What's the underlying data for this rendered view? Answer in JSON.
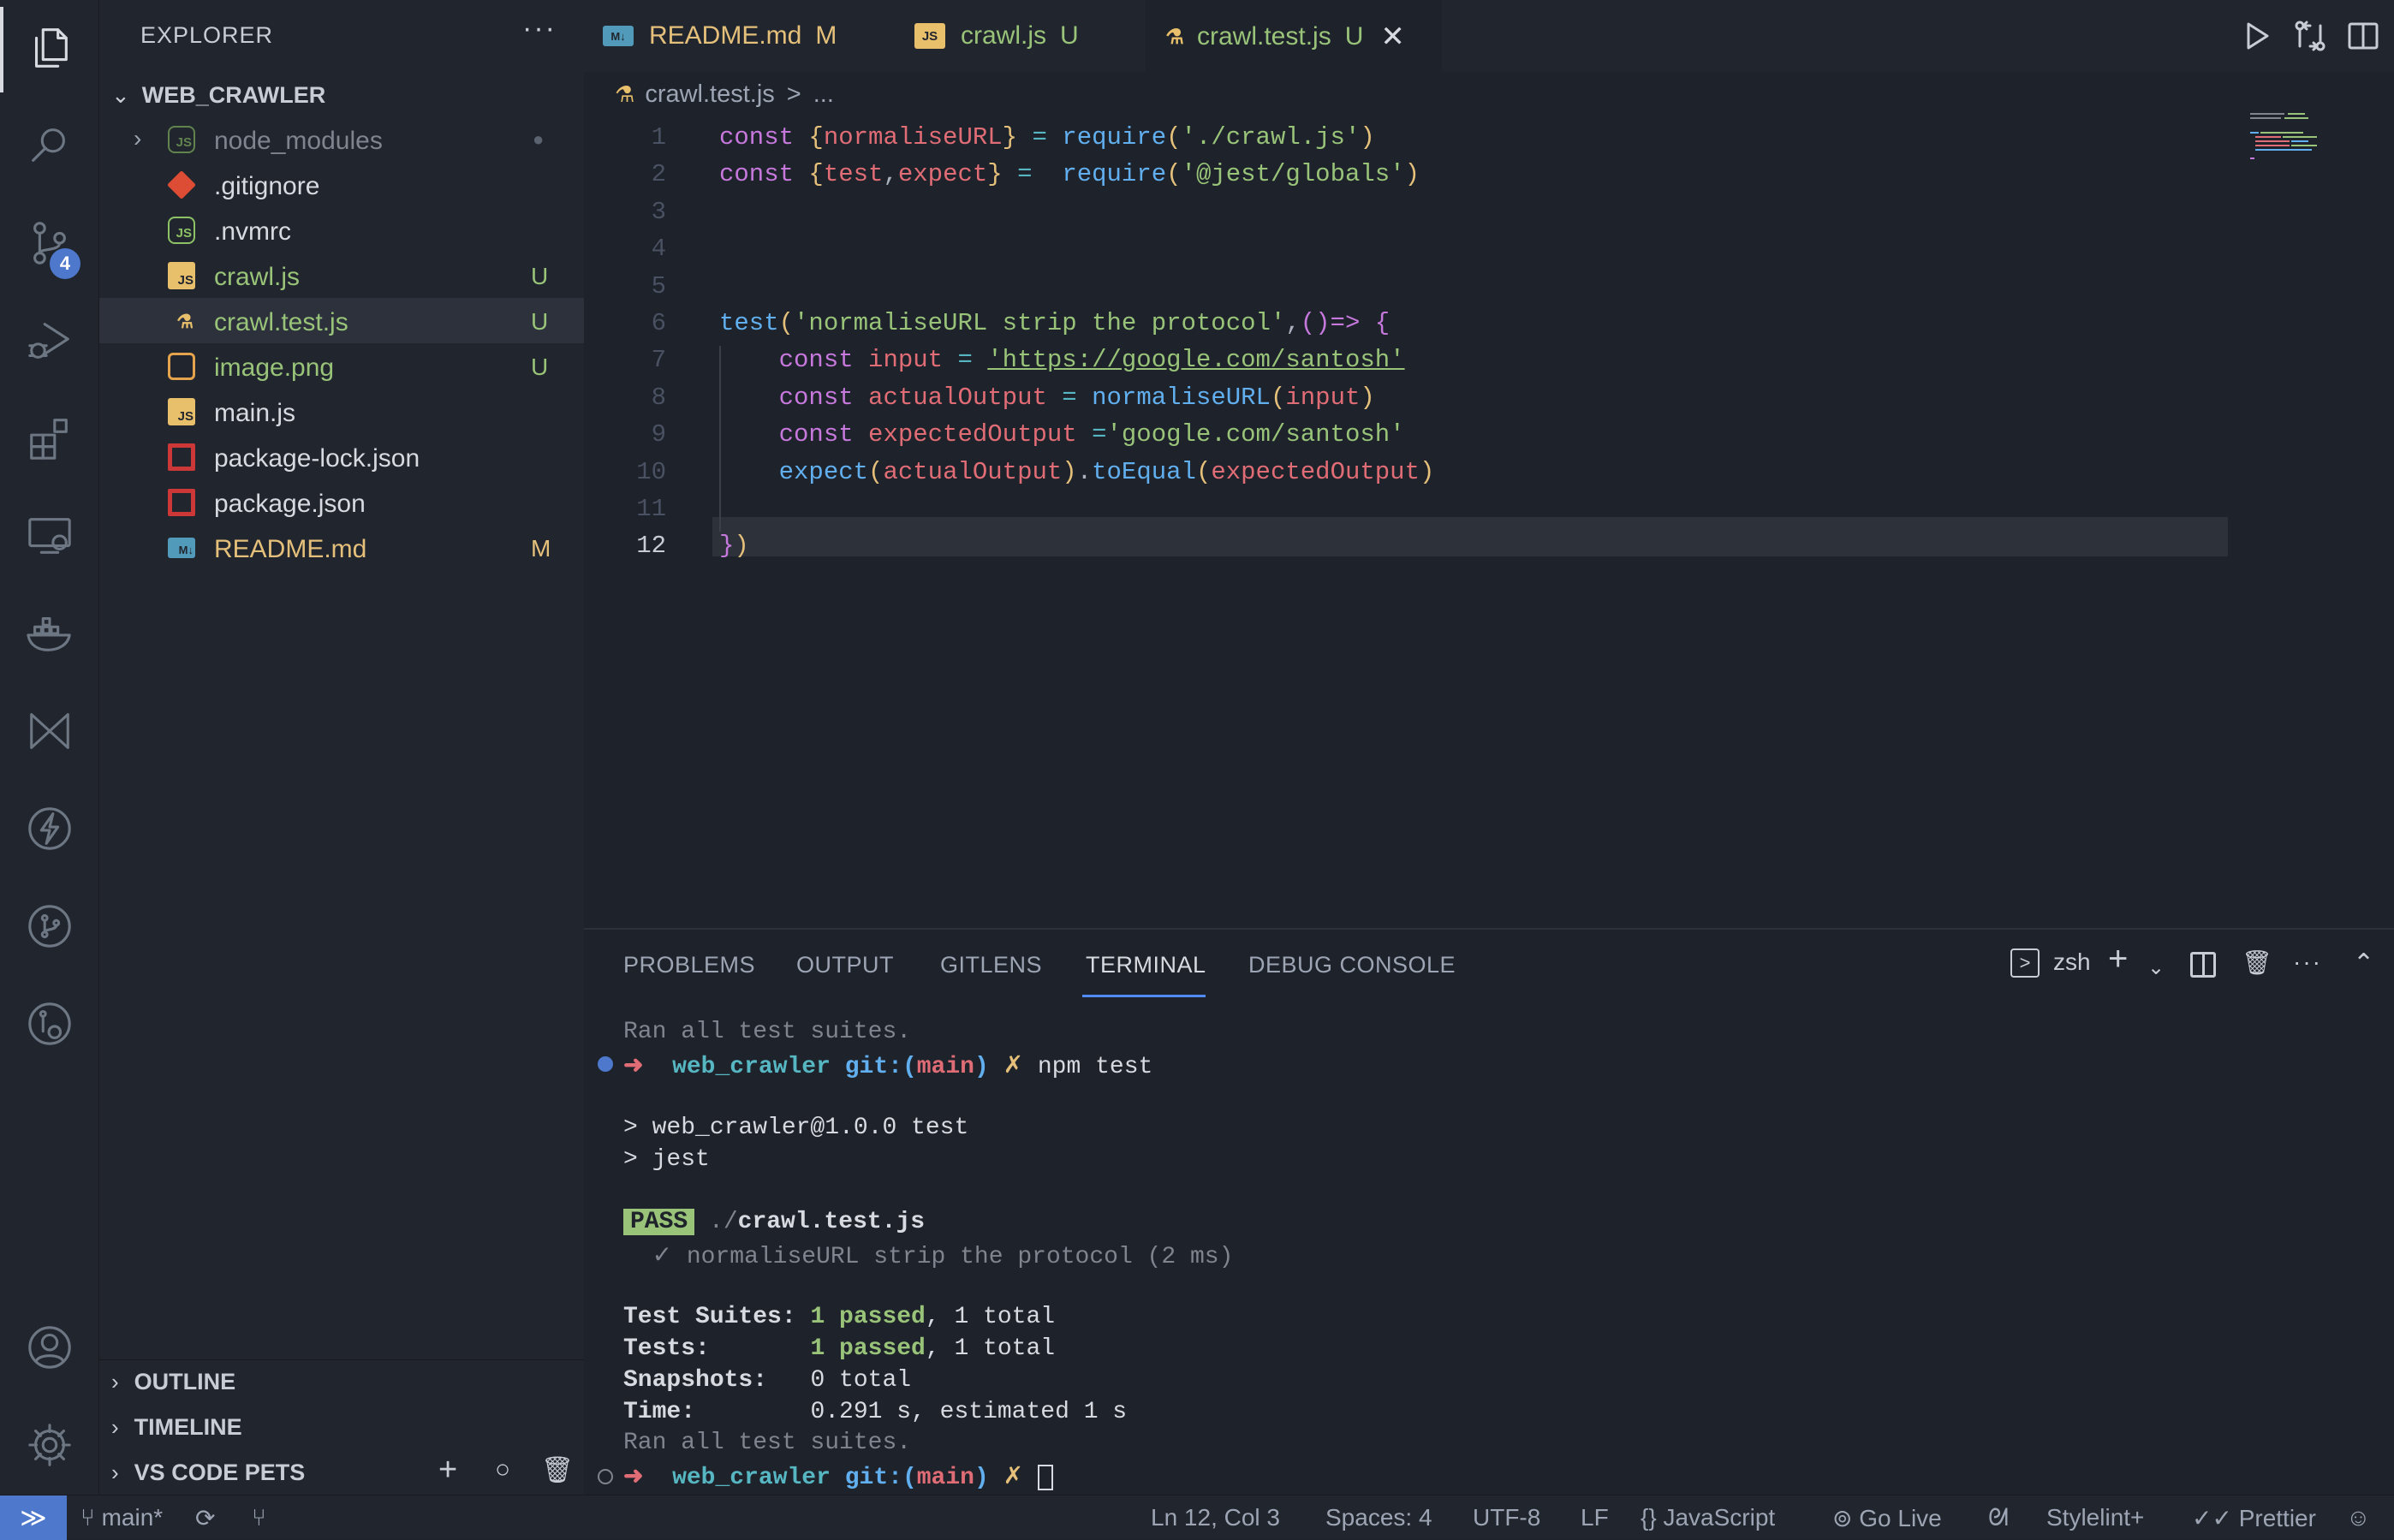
{
  "activity": {
    "scm_badge": "4"
  },
  "sidebar": {
    "title": "EXPLORER",
    "more": "···",
    "folder": "WEB_CRAWLER",
    "files": [
      {
        "name": "node_modules",
        "status": "●",
        "icon": "nodejs-icon"
      },
      {
        "name": ".gitignore",
        "status": "",
        "icon": "git-icon"
      },
      {
        "name": ".nvmrc",
        "status": "",
        "icon": "nodejs-icon"
      },
      {
        "name": "crawl.js",
        "status": "U",
        "icon": "javascript-icon"
      },
      {
        "name": "crawl.test.js",
        "status": "U",
        "icon": "test-js-icon"
      },
      {
        "name": "image.png",
        "status": "U",
        "icon": "image-icon"
      },
      {
        "name": "main.js",
        "status": "",
        "icon": "javascript-icon"
      },
      {
        "name": "package-lock.json",
        "status": "",
        "icon": "npm-icon"
      },
      {
        "name": "package.json",
        "status": "",
        "icon": "npm-icon"
      },
      {
        "name": "README.md",
        "status": "M",
        "icon": "markdown-icon"
      }
    ],
    "sections": [
      "OUTLINE",
      "TIMELINE",
      "VS CODE PETS"
    ]
  },
  "tabs": [
    {
      "label": "README.md",
      "status": "M",
      "icon": "M↓"
    },
    {
      "label": "crawl.js",
      "status": "U",
      "icon": "JS"
    },
    {
      "label": "crawl.test.js",
      "status": "U",
      "icon": "JS"
    }
  ],
  "breadcrumb": {
    "file": "crawl.test.js",
    "sep": ">",
    "rest": "..."
  },
  "editor": {
    "line_numbers": [
      "1",
      "2",
      "3",
      "4",
      "5",
      "6",
      "7",
      "8",
      "9",
      "10",
      "11",
      "12"
    ],
    "lines": [
      [
        [
          "k",
          "const "
        ],
        [
          "p",
          "{"
        ],
        [
          "v",
          "normaliseURL"
        ],
        [
          "p",
          "}"
        ],
        [
          "t",
          " "
        ],
        [
          "o",
          "="
        ],
        [
          "t",
          " "
        ],
        [
          "f",
          "require"
        ],
        [
          "p",
          "("
        ],
        [
          "s",
          "'./crawl.js'"
        ],
        [
          "p",
          ")"
        ]
      ],
      [
        [
          "k",
          "const "
        ],
        [
          "p",
          "{"
        ],
        [
          "v",
          "test"
        ],
        [
          "t",
          ","
        ],
        [
          "v",
          "expect"
        ],
        [
          "p",
          "}"
        ],
        [
          "t",
          " "
        ],
        [
          "o",
          "="
        ],
        [
          "t",
          "  "
        ],
        [
          "f",
          "require"
        ],
        [
          "p",
          "("
        ],
        [
          "s",
          "'@jest/globals'"
        ],
        [
          "p",
          ")"
        ]
      ],
      [],
      [],
      [],
      [
        [
          "f",
          "test"
        ],
        [
          "p",
          "("
        ],
        [
          "s",
          "'normaliseURL strip the protocol'"
        ],
        [
          "t",
          ","
        ],
        [
          "k",
          "()"
        ],
        [
          "k",
          "=>"
        ],
        [
          "t",
          " "
        ],
        [
          "k",
          "{"
        ]
      ],
      [
        [
          "t",
          "    "
        ],
        [
          "k",
          "const "
        ],
        [
          "v",
          "input"
        ],
        [
          "t",
          " "
        ],
        [
          "o",
          "="
        ],
        [
          "t",
          " "
        ],
        [
          "s",
          "'https://google.com/santosh'"
        ]
      ],
      [
        [
          "t",
          "    "
        ],
        [
          "k",
          "const "
        ],
        [
          "v",
          "actualOutput"
        ],
        [
          "t",
          " "
        ],
        [
          "o",
          "="
        ],
        [
          "t",
          " "
        ],
        [
          "f",
          "normaliseURL"
        ],
        [
          "p",
          "("
        ],
        [
          "v",
          "input"
        ],
        [
          "p",
          ")"
        ]
      ],
      [
        [
          "t",
          "    "
        ],
        [
          "k",
          "const "
        ],
        [
          "v",
          "expectedOutput"
        ],
        [
          "t",
          " "
        ],
        [
          "o",
          "="
        ],
        [
          "s",
          "'google.com/santosh'"
        ]
      ],
      [
        [
          "t",
          "    "
        ],
        [
          "f",
          "expect"
        ],
        [
          "p",
          "("
        ],
        [
          "v",
          "actualOutput"
        ],
        [
          "p",
          ")"
        ],
        [
          "t",
          "."
        ],
        [
          "f",
          "toEqual"
        ],
        [
          "p",
          "("
        ],
        [
          "v",
          "expectedOutput"
        ],
        [
          "p",
          ")"
        ]
      ],
      [],
      [
        [
          "k",
          "}"
        ],
        [
          "p",
          ")"
        ]
      ]
    ]
  },
  "panel": {
    "tabs": [
      "PROBLEMS",
      "OUTPUT",
      "GITLENS",
      "TERMINAL",
      "DEBUG CONSOLE"
    ],
    "active_tab": "TERMINAL",
    "shell": "zsh",
    "terminal": {
      "ran_all_1": "Ran all test suites.",
      "prompt_arrow": "➜",
      "prompt_dir": "web_crawler",
      "prompt_git": "git:(",
      "prompt_branch": "main",
      "prompt_git_close": ")",
      "prompt_dirty": "✗",
      "command": "npm test",
      "script_line1": "> web_crawler@1.0.0 test",
      "script_line2": "> jest",
      "pass_badge": "PASS",
      "pass_dir": "./",
      "pass_file": "crawl.test.js",
      "test_case": "  ✓ normaliseURL strip the protocol (2 ms)",
      "summary": [
        {
          "label": "Test Suites: ",
          "passed": "1 passed",
          "rest": ", 1 total"
        },
        {
          "label": "Tests:       ",
          "passed": "1 passed",
          "rest": ", 1 total"
        },
        {
          "label": "Snapshots:   ",
          "passed": "",
          "rest": "0 total"
        },
        {
          "label": "Time:        ",
          "passed": "",
          "rest": "0.291 s, estimated 1 s"
        }
      ],
      "ran_all_2": "Ran all test suites."
    }
  },
  "status": {
    "branch": "main*",
    "cursor": "Ln 12, Col 3",
    "spaces": "Spaces: 4",
    "encoding": "UTF-8",
    "eol": "LF",
    "language_icon": "{}",
    "language": "JavaScript",
    "golive": "Go Live",
    "stylelint": "Stylelint+",
    "prettier": "Prettier"
  },
  "colors": {
    "accent": "#4d78cc",
    "untracked": "#98c379",
    "modified": "#e5c07b"
  }
}
